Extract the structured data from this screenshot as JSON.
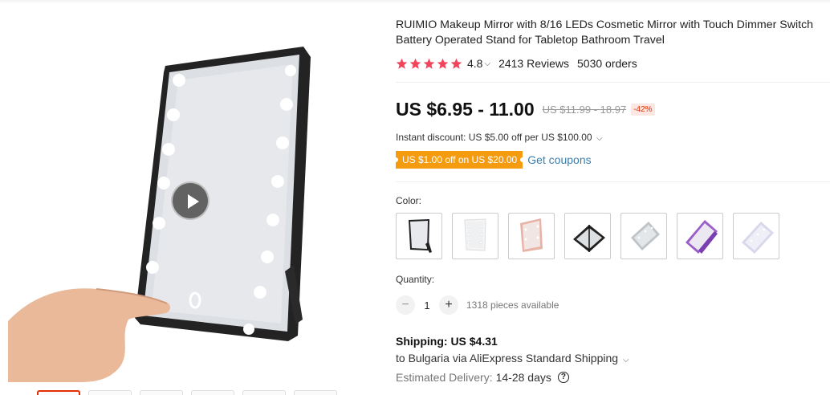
{
  "product": {
    "title": "RUIMIO Makeup Mirror with 8/16 LEDs Cosmetic Mirror with Touch Dimmer Switch Battery Operated Stand for Tabletop Bathroom Travel",
    "rating": "4.8",
    "rating_stars": 5,
    "reviews": "2413 Reviews",
    "orders": "5030 orders"
  },
  "price": {
    "current": "US $6.95 - 11.00",
    "original": "US $11.99 - 18.97",
    "discount": "-42%"
  },
  "promotions": {
    "instant_discount": "Instant discount: US $5.00 off per US $100.00",
    "coupon_tag": "US $1.00 off on US $20.00",
    "get_coupons": "Get coupons"
  },
  "options": {
    "color_label": "Color:",
    "swatches": [
      "black-standing",
      "white-standing",
      "pink-standing",
      "black-folding",
      "silver-folding",
      "purple-folding",
      "white-folding"
    ]
  },
  "quantity": {
    "label": "Quantity:",
    "value": "1",
    "minus": "−",
    "plus": "+",
    "available": "1318 pieces available"
  },
  "shipping": {
    "label": "Shipping:",
    "cost": "US $4.31",
    "destination_prefix": "to Bulgaria via",
    "method": "AliExpress Standard Shipping",
    "delivery_label": "Estimated Delivery:",
    "delivery_days": "14-28 days"
  },
  "colors": {
    "accent": "#e62e04",
    "star": "#f2445b",
    "coupon": "#f59b10",
    "link": "#3a7fb0"
  }
}
